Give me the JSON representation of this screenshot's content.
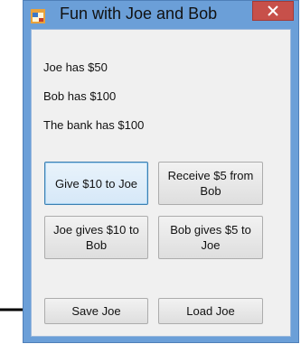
{
  "window": {
    "title": "Fun with Joe and Bob",
    "colors": {
      "frame": "#6b9fd8",
      "close": "#c7504a",
      "client": "#f0f0f0"
    }
  },
  "labels": {
    "joe": "Joe has $50",
    "bob": "Bob has $100",
    "bank": "The bank has $100"
  },
  "buttons": {
    "give": "Give $10 to Joe",
    "receive": "Receive $5 from Bob",
    "joe_gives": "Joe gives $10 to Bob",
    "bob_gives": "Bob gives $5 to Joe",
    "save": "Save Joe",
    "load": "Load Joe"
  },
  "icons": {
    "app": "form-icon",
    "close": "close-icon",
    "pointer": "arrow-right-icon"
  }
}
